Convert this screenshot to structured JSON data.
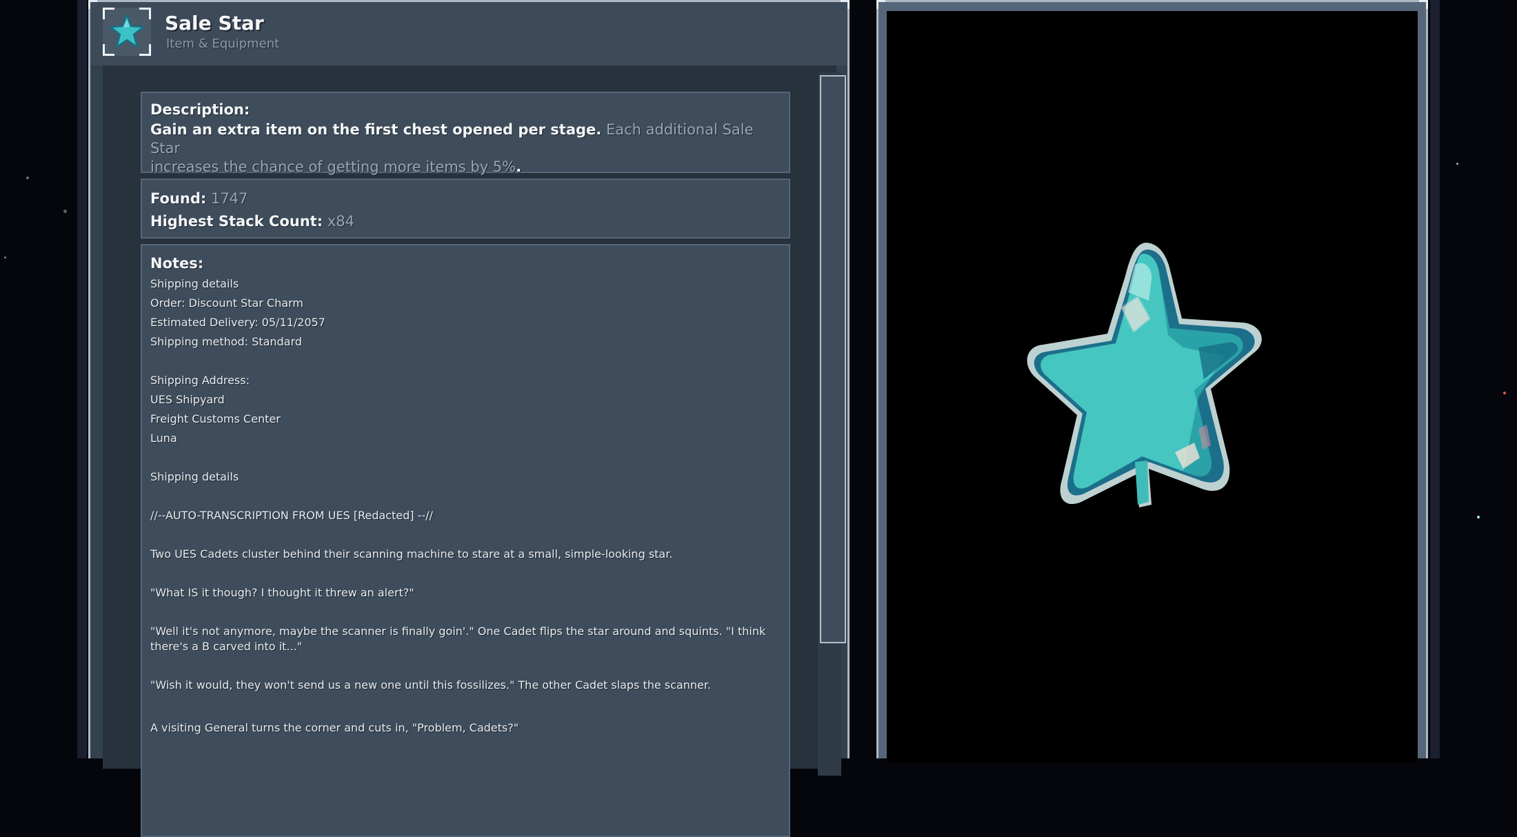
{
  "item": {
    "title": "Sale Star",
    "category": "Item & Equipment",
    "icon": "sale-star-icon"
  },
  "description": {
    "label": "Description:",
    "highlight": "Gain an extra item on the first chest opened per stage.",
    "detail_line1": "Each additional Sale Star",
    "detail_line2": "increases the chance of getting more items by 5%",
    "end": "."
  },
  "stats": {
    "found_label": "Found:",
    "found_value": "1747",
    "stack_label": "Highest Stack Count:",
    "stack_value": "x84"
  },
  "notes": {
    "label": "Notes:",
    "lines": [
      "Shipping details",
      "Order: Discount Star Charm",
      "Estimated Delivery: 05/11/2057",
      "Shipping method: Standard",
      "",
      "Shipping Address:",
      "UES Shipyard",
      "Freight Customs Center",
      "Luna",
      "",
      "Shipping details",
      "",
      "//--AUTO-TRANSCRIPTION FROM UES [Redacted] --//",
      "",
      "Two UES Cadets cluster behind their scanning machine to stare at a small, simple-looking star.",
      "",
      "\"What IS it though? I thought it threw an alert?\"",
      "",
      "\"Well it's not anymore, maybe the scanner is finally goin'.\" One Cadet flips the star around and squints. \"I think there's a B carved into it...\"",
      "",
      "\"Wish it would, they won't send us a new one until this fossilizes.\" The other Cadet slaps the scanner.",
      "",
      "A visiting General turns the corner and cuts in, \"Problem, Cadets?\""
    ]
  },
  "colors": {
    "star_main": "#45c6c1",
    "star_shadow": "#2a9fa6",
    "star_dark": "#176f86",
    "viewer_bg": "#000000"
  }
}
